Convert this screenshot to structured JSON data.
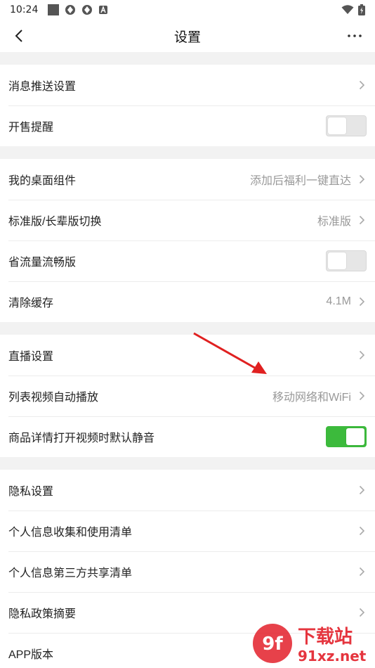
{
  "status_bar": {
    "time": "10:24"
  },
  "nav": {
    "title": "设置"
  },
  "colors": {
    "toggle_on": "#3cba3c",
    "arrow": "#e02020"
  },
  "groups": [
    {
      "rows": [
        {
          "label": "消息推送设置",
          "type": "chevron"
        },
        {
          "label": "开售提醒",
          "type": "toggle",
          "on": false
        }
      ]
    },
    {
      "rows": [
        {
          "label": "我的桌面组件",
          "value": "添加后福利一键直达",
          "type": "chevron"
        },
        {
          "label": "标准版/长辈版切换",
          "value": "标准版",
          "type": "chevron"
        },
        {
          "label": "省流量流畅版",
          "type": "toggle",
          "on": false
        },
        {
          "label": "清除缓存",
          "value": "4.1M",
          "type": "chevron"
        }
      ]
    },
    {
      "rows": [
        {
          "label": "直播设置",
          "type": "chevron"
        },
        {
          "label": "列表视频自动播放",
          "value": "移动网络和WiFi",
          "type": "chevron"
        },
        {
          "label": "商品详情打开视频时默认静音",
          "type": "toggle",
          "on": true
        }
      ]
    },
    {
      "rows": [
        {
          "label": "隐私设置",
          "type": "chevron"
        },
        {
          "label": "个人信息收集和使用清单",
          "type": "chevron"
        },
        {
          "label": "个人信息第三方共享清单",
          "type": "chevron"
        },
        {
          "label": "隐私政策摘要",
          "type": "chevron"
        },
        {
          "label": "APP版本",
          "type": "plain"
        }
      ]
    }
  ],
  "watermark": {
    "text": "下载站",
    "url": "91xz.net"
  }
}
